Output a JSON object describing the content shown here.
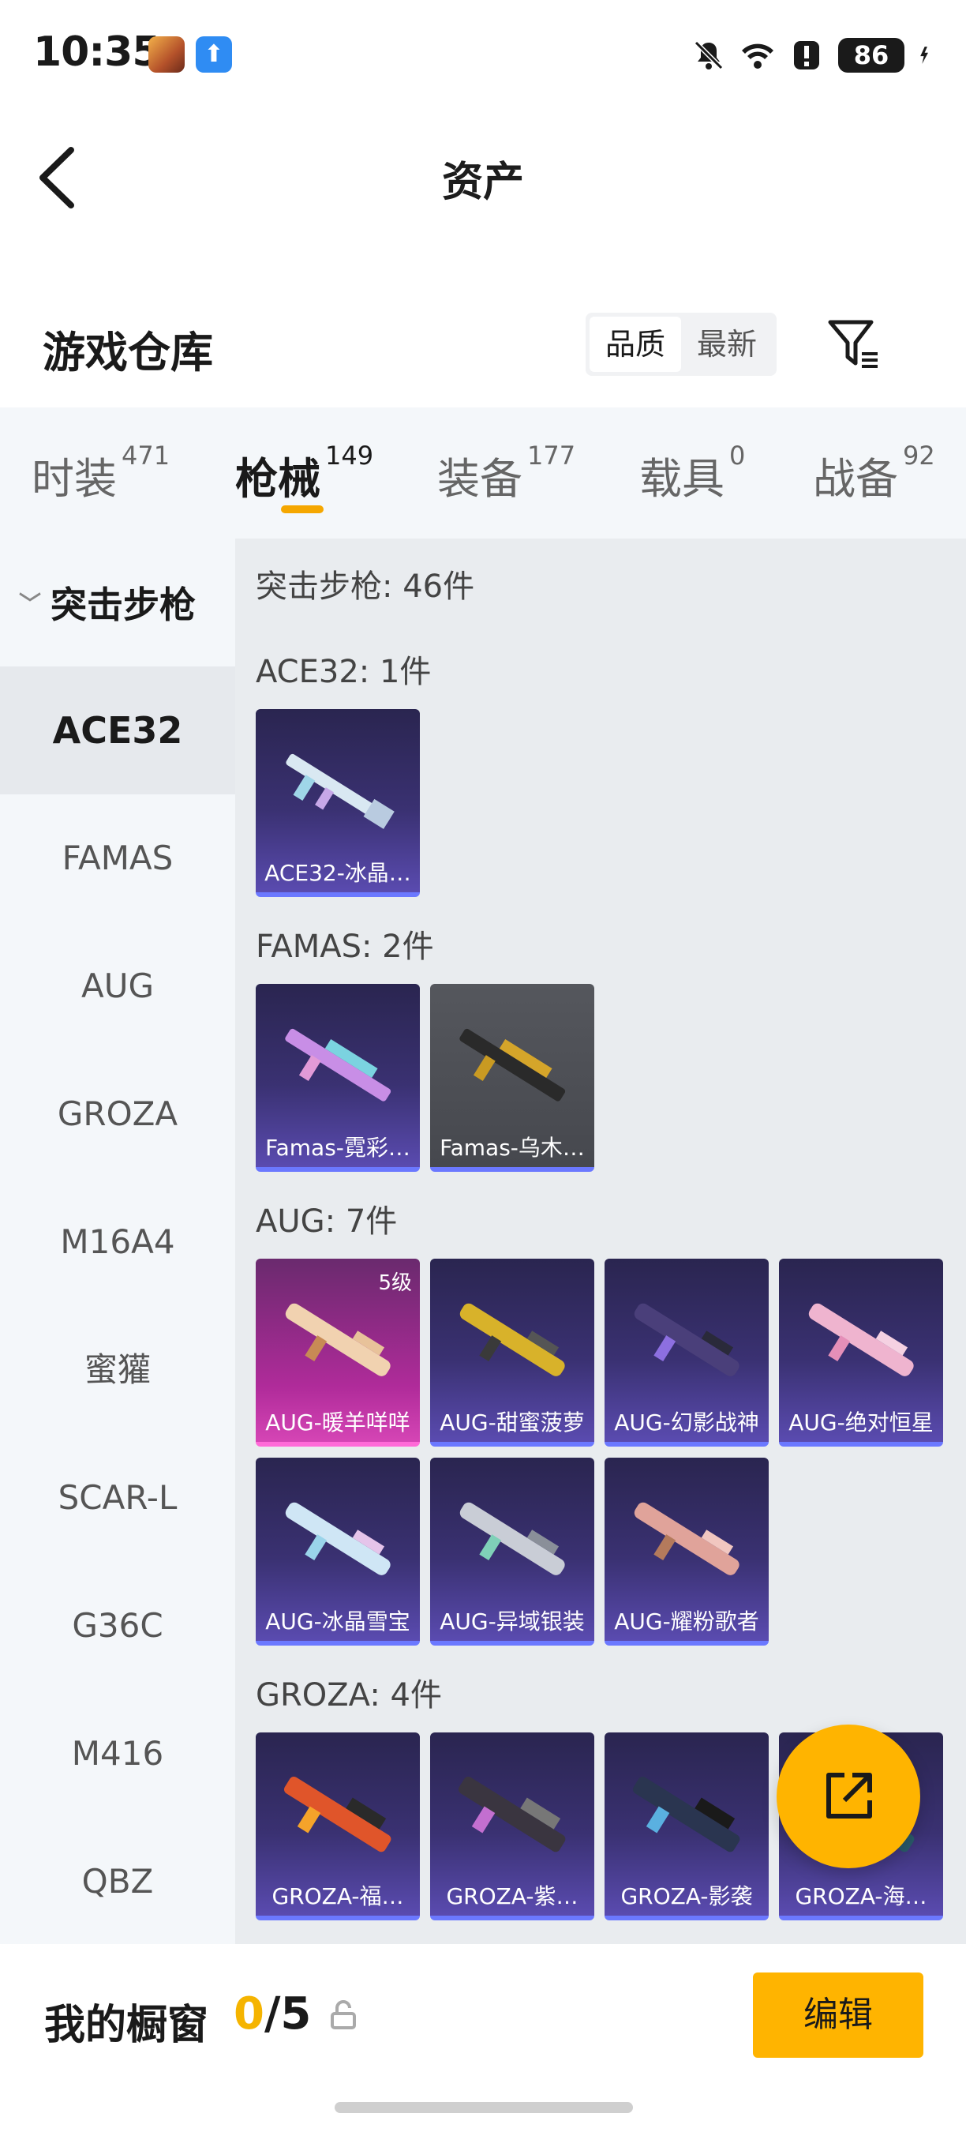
{
  "status_bar": {
    "time": "10:35",
    "battery": "86"
  },
  "header": {
    "title": "资产"
  },
  "warehouse": {
    "title": "游戏仓库",
    "sort_options": [
      {
        "label": "品质",
        "active": true
      },
      {
        "label": "最新",
        "active": false
      }
    ]
  },
  "categories": [
    {
      "label": "时装",
      "count": "471"
    },
    {
      "label": "枪械",
      "count": "149",
      "active": true
    },
    {
      "label": "装备",
      "count": "177"
    },
    {
      "label": "载具",
      "count": "0"
    },
    {
      "label": "战备",
      "count": "92"
    }
  ],
  "sidebar": {
    "group": "突击步枪",
    "items": [
      "ACE32",
      "FAMAS",
      "AUG",
      "GROZA",
      "M16A4",
      "蜜獾",
      "SCAR-L",
      "G36C",
      "M416",
      "QBZ"
    ]
  },
  "content": {
    "summary": "突击步枪: 46件",
    "sections": [
      {
        "label": "ACE32: 1件",
        "items": [
          {
            "name": "ACE32-冰晶…",
            "style": "purple"
          }
        ]
      },
      {
        "label": "FAMAS: 2件",
        "items": [
          {
            "name": "Famas-霓彩…",
            "style": "purple"
          },
          {
            "name": "Famas-乌木…",
            "style": "grey"
          }
        ]
      },
      {
        "label": "AUG: 7件",
        "items": [
          {
            "name": "AUG-暖羊咩咩",
            "style": "pink",
            "level": "5级"
          },
          {
            "name": "AUG-甜蜜菠萝",
            "style": "purple"
          },
          {
            "name": "AUG-幻影战神",
            "style": "purple"
          },
          {
            "name": "AUG-绝对恒星",
            "style": "purple"
          },
          {
            "name": "AUG-冰晶雪宝",
            "style": "purple"
          },
          {
            "name": "AUG-异域银装",
            "style": "purple"
          },
          {
            "name": "AUG-耀粉歌者",
            "style": "purple"
          }
        ]
      },
      {
        "label": "GROZA: 4件",
        "items": [
          {
            "name": "GROZA-福…",
            "style": "purple"
          },
          {
            "name": "GROZA-紫…",
            "style": "purple"
          },
          {
            "name": "GROZA-影袭",
            "style": "purple"
          },
          {
            "name": "GROZA-海…",
            "style": "purple"
          }
        ]
      }
    ]
  },
  "showcase": {
    "title": "我的橱窗",
    "used": "0",
    "total": "/5",
    "edit_label": "编辑"
  },
  "colors": {
    "accent": "#ffb400",
    "tab_underline": "#f5a700",
    "card_purple": "#3a3172",
    "card_pink": "#b02b9a"
  }
}
